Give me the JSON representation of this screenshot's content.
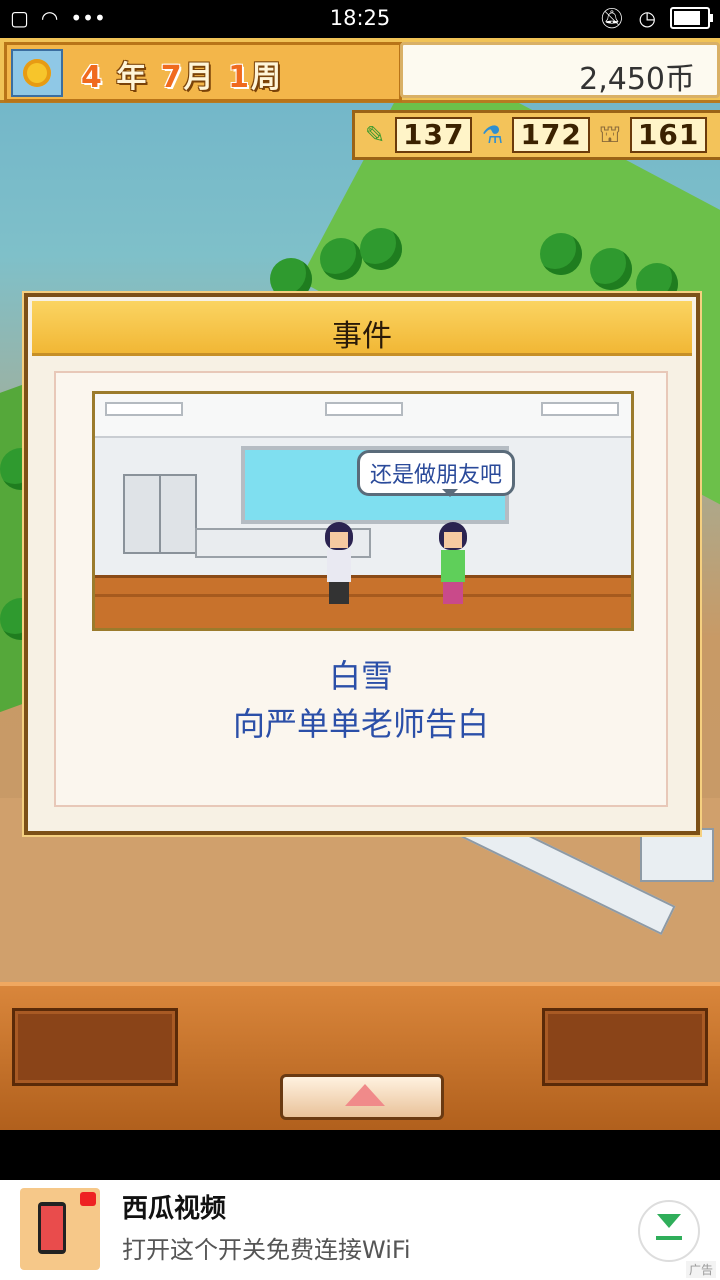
{
  "status_bar": {
    "time": "18:25",
    "left_icons": [
      "sim-icon",
      "wifi-icon",
      "more-icon"
    ],
    "right_icons": [
      "mute-icon",
      "alarm-icon",
      "battery-icon"
    ]
  },
  "hud": {
    "date": {
      "year_num": "4",
      "year_unit": "年",
      "month_num": "7",
      "month_unit": "月",
      "week_num": "1",
      "week_unit": "周"
    },
    "money": "2,450币",
    "stats": [
      {
        "icon": "pencil-icon",
        "value": "137"
      },
      {
        "icon": "flask-icon",
        "value": "172"
      },
      {
        "icon": "bell-icon",
        "value": "161"
      }
    ]
  },
  "dialog": {
    "title": "事件",
    "speech": "还是做朋友吧",
    "character_name": "白雪",
    "event_text": "向严单单老师告白"
  },
  "ad": {
    "title": "西瓜视频",
    "description": "打开这个开关免费连接WiFi",
    "label": "广告"
  },
  "colors": {
    "hud_bg": "#f1c356",
    "dialog_title_bg": "#f1b735",
    "message_text": "#2b4fa8",
    "bottom_panel": "#b05f1c"
  }
}
